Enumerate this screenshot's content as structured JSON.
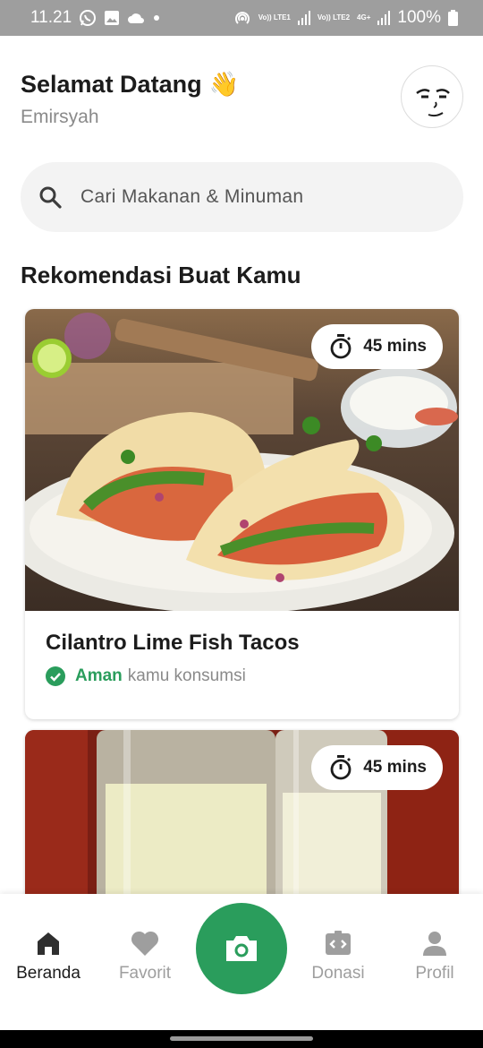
{
  "status_bar": {
    "time": "11.21",
    "sim1": "Vo)) LTE1",
    "sim2": "Vo)) LTE2",
    "network": "4G+",
    "battery": "100%"
  },
  "header": {
    "greeting": "Selamat Datang",
    "wave_emoji": "👋",
    "username": "Emirsyah",
    "avatar_icon": "smirk-face-avatar"
  },
  "search": {
    "placeholder": "Cari Makanan & Minuman"
  },
  "recommendations": {
    "title": "Rekomendasi Buat Kamu",
    "items": [
      {
        "time_label": "45 mins",
        "title": "Cilantro Lime Fish Tacos",
        "safety_status": "Aman",
        "safety_text": "kamu konsumsi",
        "image": "fish-tacos-photo"
      },
      {
        "time_label": "45 mins",
        "image": "drink-bottles-photo"
      }
    ]
  },
  "bottom_nav": {
    "items": [
      {
        "label": "Beranda",
        "icon": "home-icon",
        "active": true
      },
      {
        "label": "Favorit",
        "icon": "heart-icon",
        "active": false
      },
      {
        "label": "",
        "icon": "camera-icon",
        "active": false
      },
      {
        "label": "Donasi",
        "icon": "donate-box-icon",
        "active": false
      },
      {
        "label": "Profil",
        "icon": "person-icon",
        "active": false
      }
    ]
  },
  "colors": {
    "accent_green": "#2a9d5c",
    "status_bar": "#9e9e9e",
    "search_bg": "#f3f3f3"
  }
}
